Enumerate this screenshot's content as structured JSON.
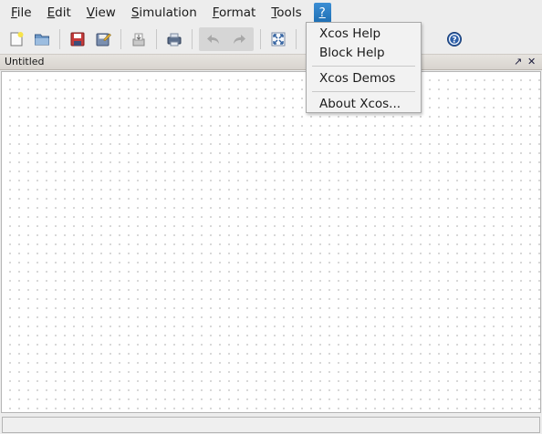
{
  "menubar": {
    "items": [
      {
        "mnemonic": "F",
        "rest": "ile"
      },
      {
        "mnemonic": "E",
        "rest": "dit"
      },
      {
        "mnemonic": "V",
        "rest": "iew"
      },
      {
        "mnemonic": "S",
        "rest": "imulation"
      },
      {
        "mnemonic": "F",
        "rest": "ormat"
      },
      {
        "mnemonic": "T",
        "rest": "ools"
      },
      {
        "mnemonic": "?",
        "rest": ""
      }
    ]
  },
  "toolbar": {
    "icons": [
      "new-diagram-icon",
      "open-icon",
      "save-icon",
      "save-as-icon",
      "export-icon",
      "print-icon",
      "undo-icon",
      "redo-icon",
      "fit-diagram-icon",
      "start-icon",
      "help-icon"
    ]
  },
  "document": {
    "title": "Untitled",
    "undock_glyph": "↗",
    "close_glyph": "✕"
  },
  "help_menu": {
    "items": [
      "Xcos Help",
      "Block Help",
      "Xcos Demos",
      "About Xcos..."
    ]
  },
  "colors": {
    "menu_active": "#2a7cc4",
    "canvas_background": "#ffffff",
    "grid_dot": "#b4b4b4"
  }
}
